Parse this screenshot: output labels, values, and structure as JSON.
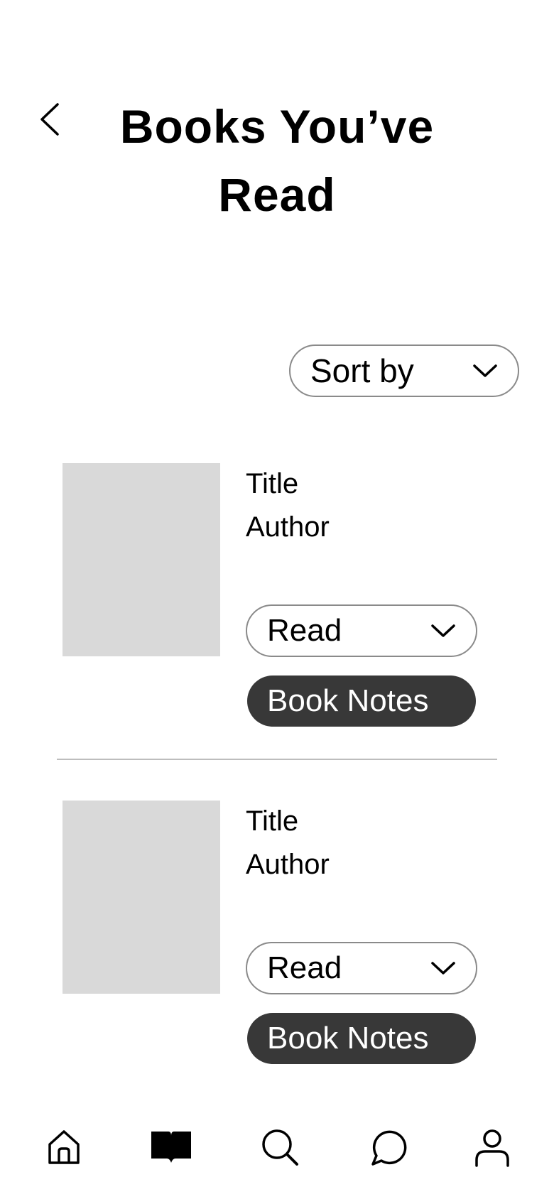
{
  "header": {
    "title": "Books You’ve Read",
    "back_icon": "chevron-left-icon"
  },
  "sort": {
    "label": "Sort by",
    "icon": "chevron-down-icon"
  },
  "books": [
    {
      "title": "Title",
      "author": "Author",
      "status": "Read",
      "notes_label": "Book Notes"
    },
    {
      "title": "Title",
      "author": "Author",
      "status": "Read",
      "notes_label": "Book Notes"
    }
  ],
  "nav": {
    "items": [
      "home-icon",
      "book-icon",
      "search-icon",
      "chat-icon",
      "profile-icon"
    ],
    "active": "book-icon"
  },
  "colors": {
    "cover_placeholder": "#d9d9d9",
    "button_dark": "#383838",
    "outline": "#8a8a8a"
  }
}
